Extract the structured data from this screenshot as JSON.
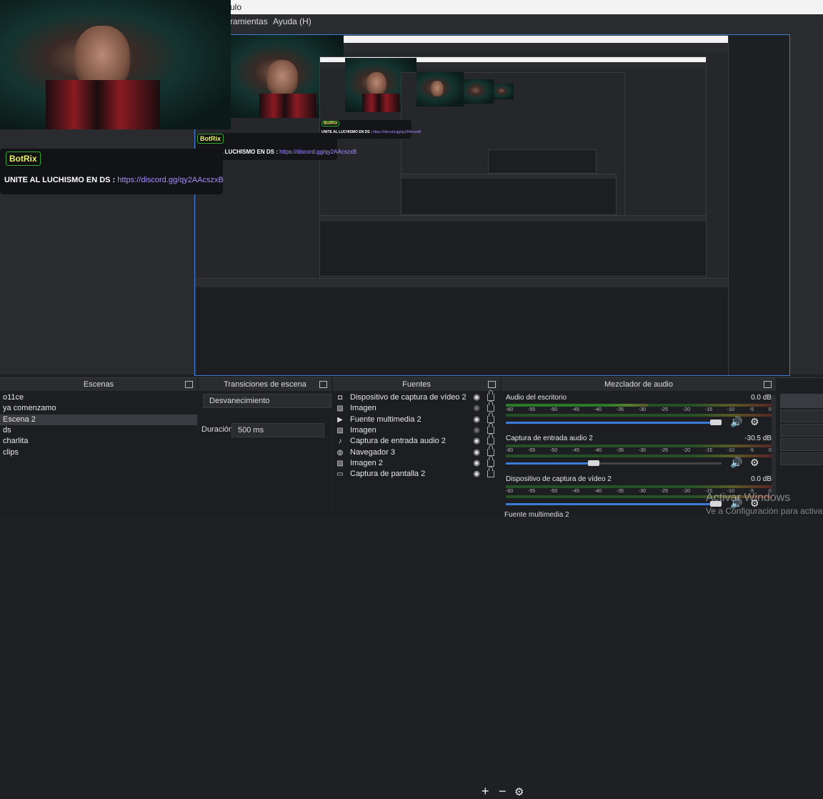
{
  "window": {
    "title_fragment": "ulo"
  },
  "menu": {
    "items": [
      "ramientas",
      "Ayuda (H)"
    ]
  },
  "overlay": {
    "botrix_label": "BotRix",
    "message_prefix": "UNITE AL LUCHISMO EN DS :",
    "message_link": "https://discord.gg/qy2AAcszxB"
  },
  "scenes": {
    "title": "Escenas",
    "items": [
      "o11ce",
      "ya comenzamo",
      "Escena 2",
      "ds",
      "charlita",
      "clips"
    ],
    "selected_index": 2
  },
  "transitions": {
    "title": "Transiciones de escena",
    "type": "Desvanecimiento",
    "duration_label": "Duración",
    "duration_value": "500 ms"
  },
  "sources": {
    "title": "Fuentes",
    "items": [
      {
        "label": "Dispositivo de captura de vídeo 2",
        "icon": "camera-icon",
        "visible": true
      },
      {
        "label": "Imagen",
        "icon": "image-icon",
        "visible": false
      },
      {
        "label": "Fuente multimedia 2",
        "icon": "play-icon",
        "visible": true
      },
      {
        "label": "Imagen",
        "icon": "image-icon",
        "visible": false
      },
      {
        "label": "Captura de entrada audio 2",
        "icon": "microphone-icon",
        "visible": true
      },
      {
        "label": "Navegador 3",
        "icon": "globe-icon",
        "visible": true
      },
      {
        "label": "Imagen 2",
        "icon": "image-icon",
        "visible": true
      },
      {
        "label": "Captura de pantalla 2",
        "icon": "monitor-icon",
        "visible": true
      }
    ]
  },
  "mixer": {
    "title": "Mezclador de audio",
    "ticks": [
      "-60",
      "-55",
      "-50",
      "-45",
      "-40",
      "-35",
      "-30",
      "-25",
      "-20",
      "-15",
      "-10",
      "-5",
      "0"
    ],
    "channels": [
      {
        "name": "Audio del escritorio",
        "db": "0.0 dB",
        "volume": 1.0,
        "level": 0.55
      },
      {
        "name": "Captura de entrada audio 2",
        "db": "-30.5 dB",
        "volume": 0.38,
        "level": 0.0
      },
      {
        "name": "Dispositivo de captura de vídeo 2",
        "db": "0.0 dB",
        "volume": 1.0,
        "level": 0.0
      }
    ],
    "partial_channel": "Fuente multimedia 2"
  },
  "watermark": {
    "line1": "Activar Windows",
    "line2": "Ve a Configuración para activar Windows."
  },
  "colors": {
    "accent": "#3b7bd8",
    "panel": "#1d1e21",
    "header": "#2b2c30"
  }
}
